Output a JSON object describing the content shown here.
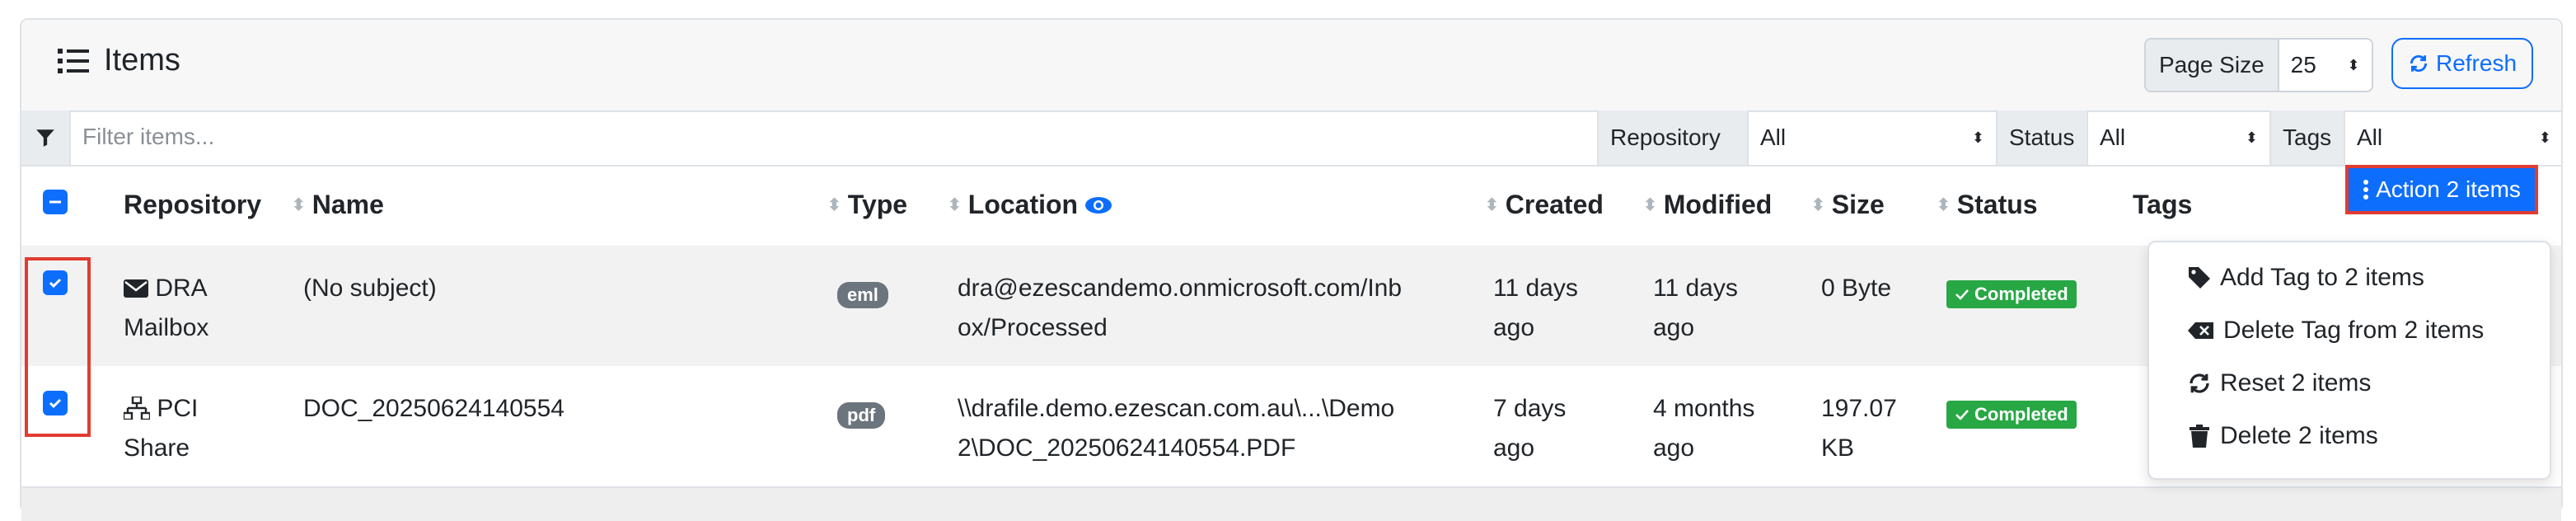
{
  "header": {
    "title": "Items",
    "page_size_label": "Page Size",
    "page_size_value": "25",
    "refresh_label": "Refresh"
  },
  "filters": {
    "placeholder": "Filter items...",
    "repository_label": "Repository",
    "repository_value": "All",
    "status_label": "Status",
    "status_value": "All",
    "tags_label": "Tags",
    "tags_value": "All"
  },
  "columns": {
    "repository": "Repository",
    "name": "Name",
    "type": "Type",
    "location": "Location",
    "created": "Created",
    "modified": "Modified",
    "size": "Size",
    "status": "Status",
    "tags": "Tags"
  },
  "action_button_label": "Action 2 items",
  "rows": [
    {
      "repo_line1": "DRA",
      "repo_line2": "Mailbox",
      "name": "(No subject)",
      "type": "eml",
      "location_line1": "dra@ezescandemo.onmicrosoft.com/Inb",
      "location_line2": "ox/Processed",
      "created_line1": "11 days",
      "created_line2": "ago",
      "modified_line1": "11 days",
      "modified_line2": "ago",
      "size_line1": "0 Byte",
      "size_line2": "",
      "status": "Completed"
    },
    {
      "repo_line1": "PCI",
      "repo_line2": "Share",
      "name": "DOC_20250624140554",
      "type": "pdf",
      "location_line1": "\\\\drafile.demo.ezescan.com.au\\...\\Demo",
      "location_line2": "2\\DOC_20250624140554.PDF",
      "created_line1": "7 days",
      "created_line2": "ago",
      "modified_line1": "4 months",
      "modified_line2": "ago",
      "size_line1": "197.07",
      "size_line2": "KB",
      "status": "Completed"
    }
  ],
  "menu": {
    "add_tag": "Add Tag to 2 items",
    "delete_tag": "Delete Tag from 2 items",
    "reset": "Reset 2 items",
    "delete": "Delete 2 items"
  },
  "colors": {
    "primary": "#0d6efd",
    "success": "#28a745",
    "highlight_red": "#e03c31"
  }
}
